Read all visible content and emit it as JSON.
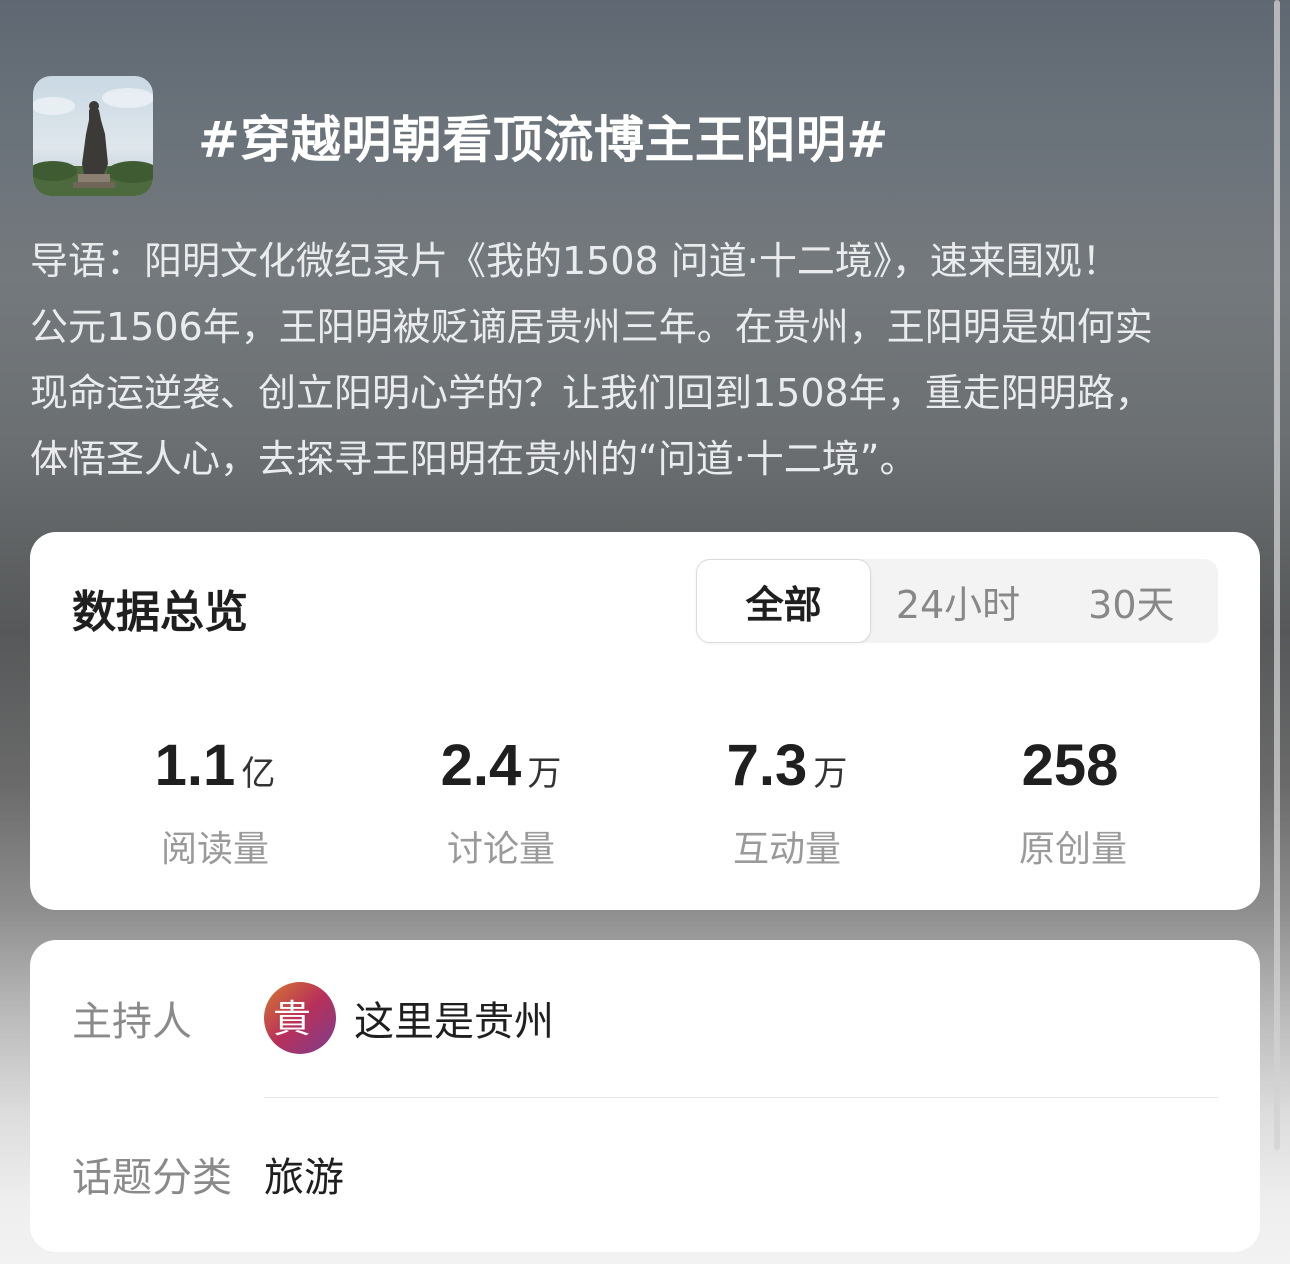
{
  "topic": {
    "title": "#穿越明朝看顶流博主王阳明#",
    "intro_lines": [
      "导语：阳明文化微纪录片《我的1508 问道·十二境》，速来围观！",
      "公元1506年，王阳明被贬谪居贵州三年。在贵州，王阳明是如何实",
      "现命运逆袭、创立阳明心学的？让我们回到1508年，重走阳明路，",
      "体悟圣人心，去探寻王阳明在贵州的“问道·十二境”。"
    ]
  },
  "overview": {
    "title": "数据总览",
    "tabs": [
      {
        "label": "全部",
        "active": true
      },
      {
        "label": "24小时",
        "active": false
      },
      {
        "label": "30天",
        "active": false
      }
    ],
    "stats": [
      {
        "value": "1.1",
        "unit": "亿",
        "label": "阅读量"
      },
      {
        "value": "2.4",
        "unit": "万",
        "label": "讨论量"
      },
      {
        "value": "7.3",
        "unit": "万",
        "label": "互动量"
      },
      {
        "value": "258",
        "unit": "",
        "label": "原创量"
      }
    ]
  },
  "info": {
    "host_label": "主持人",
    "host_name": "这里是贵州",
    "host_avatar_text": "貴",
    "category_label": "话题分类",
    "category_value": "旅游"
  },
  "colors": {
    "card_bg": "#ffffff",
    "text_primary": "#1f1f1f",
    "text_secondary": "#9a9a9a"
  }
}
